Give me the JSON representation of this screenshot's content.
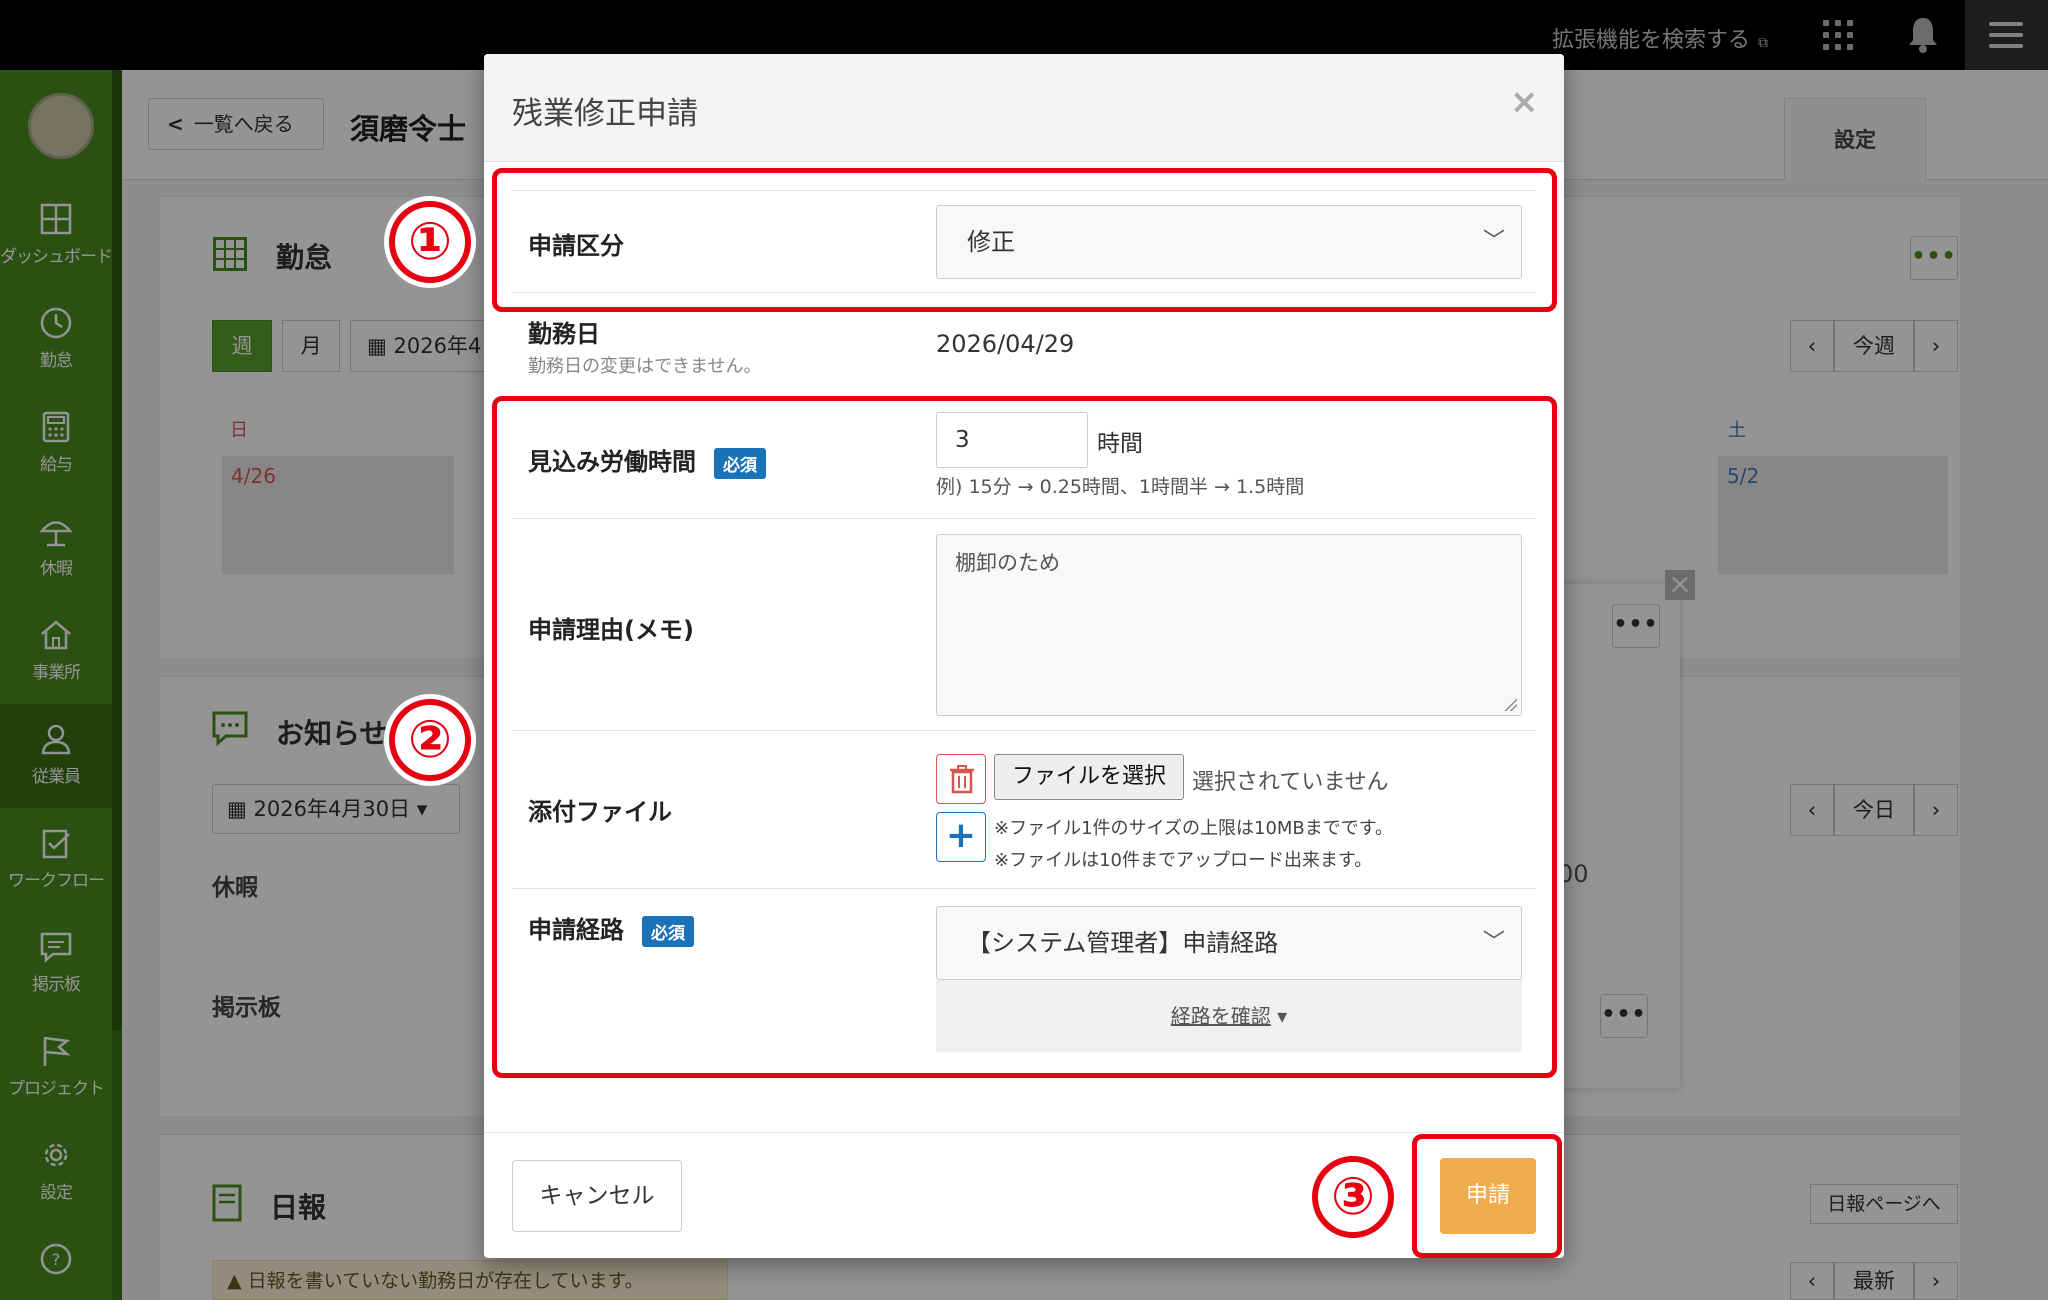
{
  "topbar": {
    "extension_search": "拡張機能を検索する",
    "external_mark": "⧉"
  },
  "sidebar": {
    "items": [
      {
        "label": "ダッシュボード",
        "icon": "dashboard-icon"
      },
      {
        "label": "勤怠",
        "icon": "clock-icon"
      },
      {
        "label": "給与",
        "icon": "calculator-icon"
      },
      {
        "label": "休暇",
        "icon": "umbrella-icon"
      },
      {
        "label": "事業所",
        "icon": "home-icon"
      },
      {
        "label": "従業員",
        "icon": "person-icon"
      },
      {
        "label": "ワークフロー",
        "icon": "clipboard-check-icon"
      },
      {
        "label": "掲示板",
        "icon": "chat-icon"
      },
      {
        "label": "プロジェクト",
        "icon": "flag-icon"
      },
      {
        "label": "設定",
        "icon": "gear-icon"
      },
      {
        "label": "",
        "icon": "help-icon"
      }
    ]
  },
  "header": {
    "back_label": "一覧へ戻る",
    "employee_name": "須磨令士",
    "settings_tab": "設定"
  },
  "attendance": {
    "title": "勤怠",
    "week_btn": "週",
    "month_btn": "月",
    "date_btn": "2026年4",
    "prev": "‹",
    "this_week": "今週",
    "next": "›",
    "sun_label": "日",
    "sat_label": "土",
    "sun_date": "4/26",
    "sat_date": "5/2"
  },
  "notice": {
    "title": "お知らせ",
    "date_dropdown": "2026年4月30日",
    "today": "今日",
    "leave_label": "休暇",
    "board_label": "掲示板",
    "partial_value": "00"
  },
  "daily_report": {
    "title": "日報",
    "page_link": "日報ページへ",
    "warning": "日報を書いていない勤務日が存在しています。",
    "latest": "最新"
  },
  "modal": {
    "title": "残業修正申請",
    "close": "×",
    "category": {
      "label": "申請区分",
      "value": "修正"
    },
    "work_date": {
      "label": "勤務日",
      "note": "勤務日の変更はできません。",
      "value": "2026/04/29"
    },
    "hours": {
      "label": "見込み労働時間",
      "required": "必須",
      "value": "3",
      "unit": "時間",
      "hint": "例) 15分 → 0.25時間、1時間半 → 1.5時間"
    },
    "reason": {
      "label": "申請理由(メモ)",
      "value": "棚卸のため"
    },
    "attachment": {
      "label": "添付ファイル",
      "choose_btn": "ファイルを選択",
      "status": "選択されていません",
      "note1": "※ファイル1件のサイズの上限は10MBまでです。",
      "note2": "※ファイルは10件までアップロード出来ます。"
    },
    "route": {
      "label": "申請経路",
      "required": "必須",
      "value": "【システム管理者】申請経路",
      "confirm": "経路を確認"
    },
    "cancel_btn": "キャンセル",
    "submit_btn": "申請"
  },
  "annotations": [
    "①",
    "②",
    "③"
  ],
  "colors": {
    "accent_green": "#4b8c1f",
    "annotation_red": "#e60012",
    "submit_orange": "#f0ad4e",
    "badge_blue": "#1a73b8"
  }
}
